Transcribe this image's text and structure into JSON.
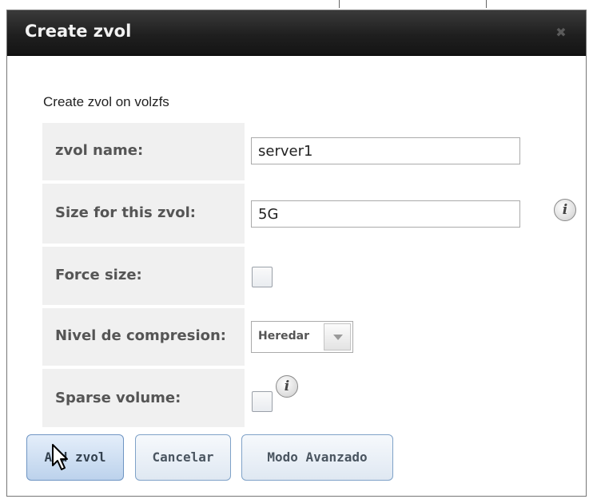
{
  "dialog": {
    "title": "Create zvol",
    "close_icon": "close-icon",
    "subtitle": "Create zvol on volzfs"
  },
  "form": {
    "zvol_name": {
      "label": "zvol name:",
      "value": "server1"
    },
    "size": {
      "label": "Size for this zvol:",
      "value": "5G",
      "info_icon": "info-icon"
    },
    "force_size": {
      "label": "Force size:",
      "checked": false
    },
    "compression": {
      "label": "Nivel de compresion:",
      "selected": "Heredar"
    },
    "sparse": {
      "label": "Sparse volume:",
      "checked": false,
      "info_icon": "info-icon"
    }
  },
  "buttons": {
    "add": "Add zvol",
    "cancel": "Cancelar",
    "advanced": "Modo Avanzado"
  },
  "colors": {
    "titlebar": "#1f1f1f",
    "button_border": "#7fa2c8",
    "label_background": "#f0f0f0"
  }
}
